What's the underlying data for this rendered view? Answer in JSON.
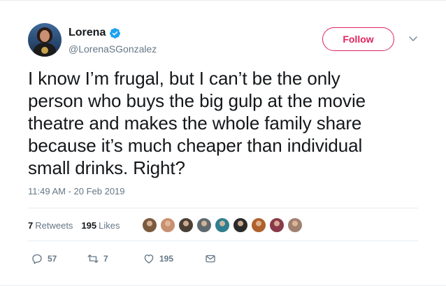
{
  "user": {
    "display_name": "Lorena",
    "handle": "@LorenaSGonzalez",
    "verified": true
  },
  "follow": {
    "label": "Follow"
  },
  "tweet": {
    "text": "I know I’m frugal, but I can’t be the only\nperson who buys the big gulp at the movie\ntheatre and makes the whole family share\nbecause it’s much cheaper than individual\nsmall drinks. Right?",
    "timestamp": "11:49 AM - 20 Feb 2019"
  },
  "stats": {
    "retweets_count": "7",
    "retweets_label": "Retweets",
    "likes_count": "195",
    "likes_label": "Likes"
  },
  "likers": [
    {
      "color": "#7a5a3e",
      "name": "liker-avatar-1"
    },
    {
      "color": "#c89070",
      "name": "liker-avatar-2"
    },
    {
      "color": "#4a4036",
      "name": "liker-avatar-3"
    },
    {
      "color": "#5f6a6e",
      "name": "liker-avatar-4"
    },
    {
      "color": "#2f7f8f",
      "name": "liker-avatar-5"
    },
    {
      "color": "#2a2a2a",
      "name": "liker-avatar-6"
    },
    {
      "color": "#b0602a",
      "name": "liker-avatar-7"
    },
    {
      "color": "#8a3a4a",
      "name": "liker-avatar-8"
    },
    {
      "color": "#a08070",
      "name": "liker-avatar-9"
    }
  ],
  "actions": {
    "reply_count": "57",
    "retweet_count": "7",
    "like_count": "195"
  },
  "colors": {
    "accent_pink": "#e0245e",
    "verified_blue": "#1da1f2",
    "muted": "#657786"
  }
}
